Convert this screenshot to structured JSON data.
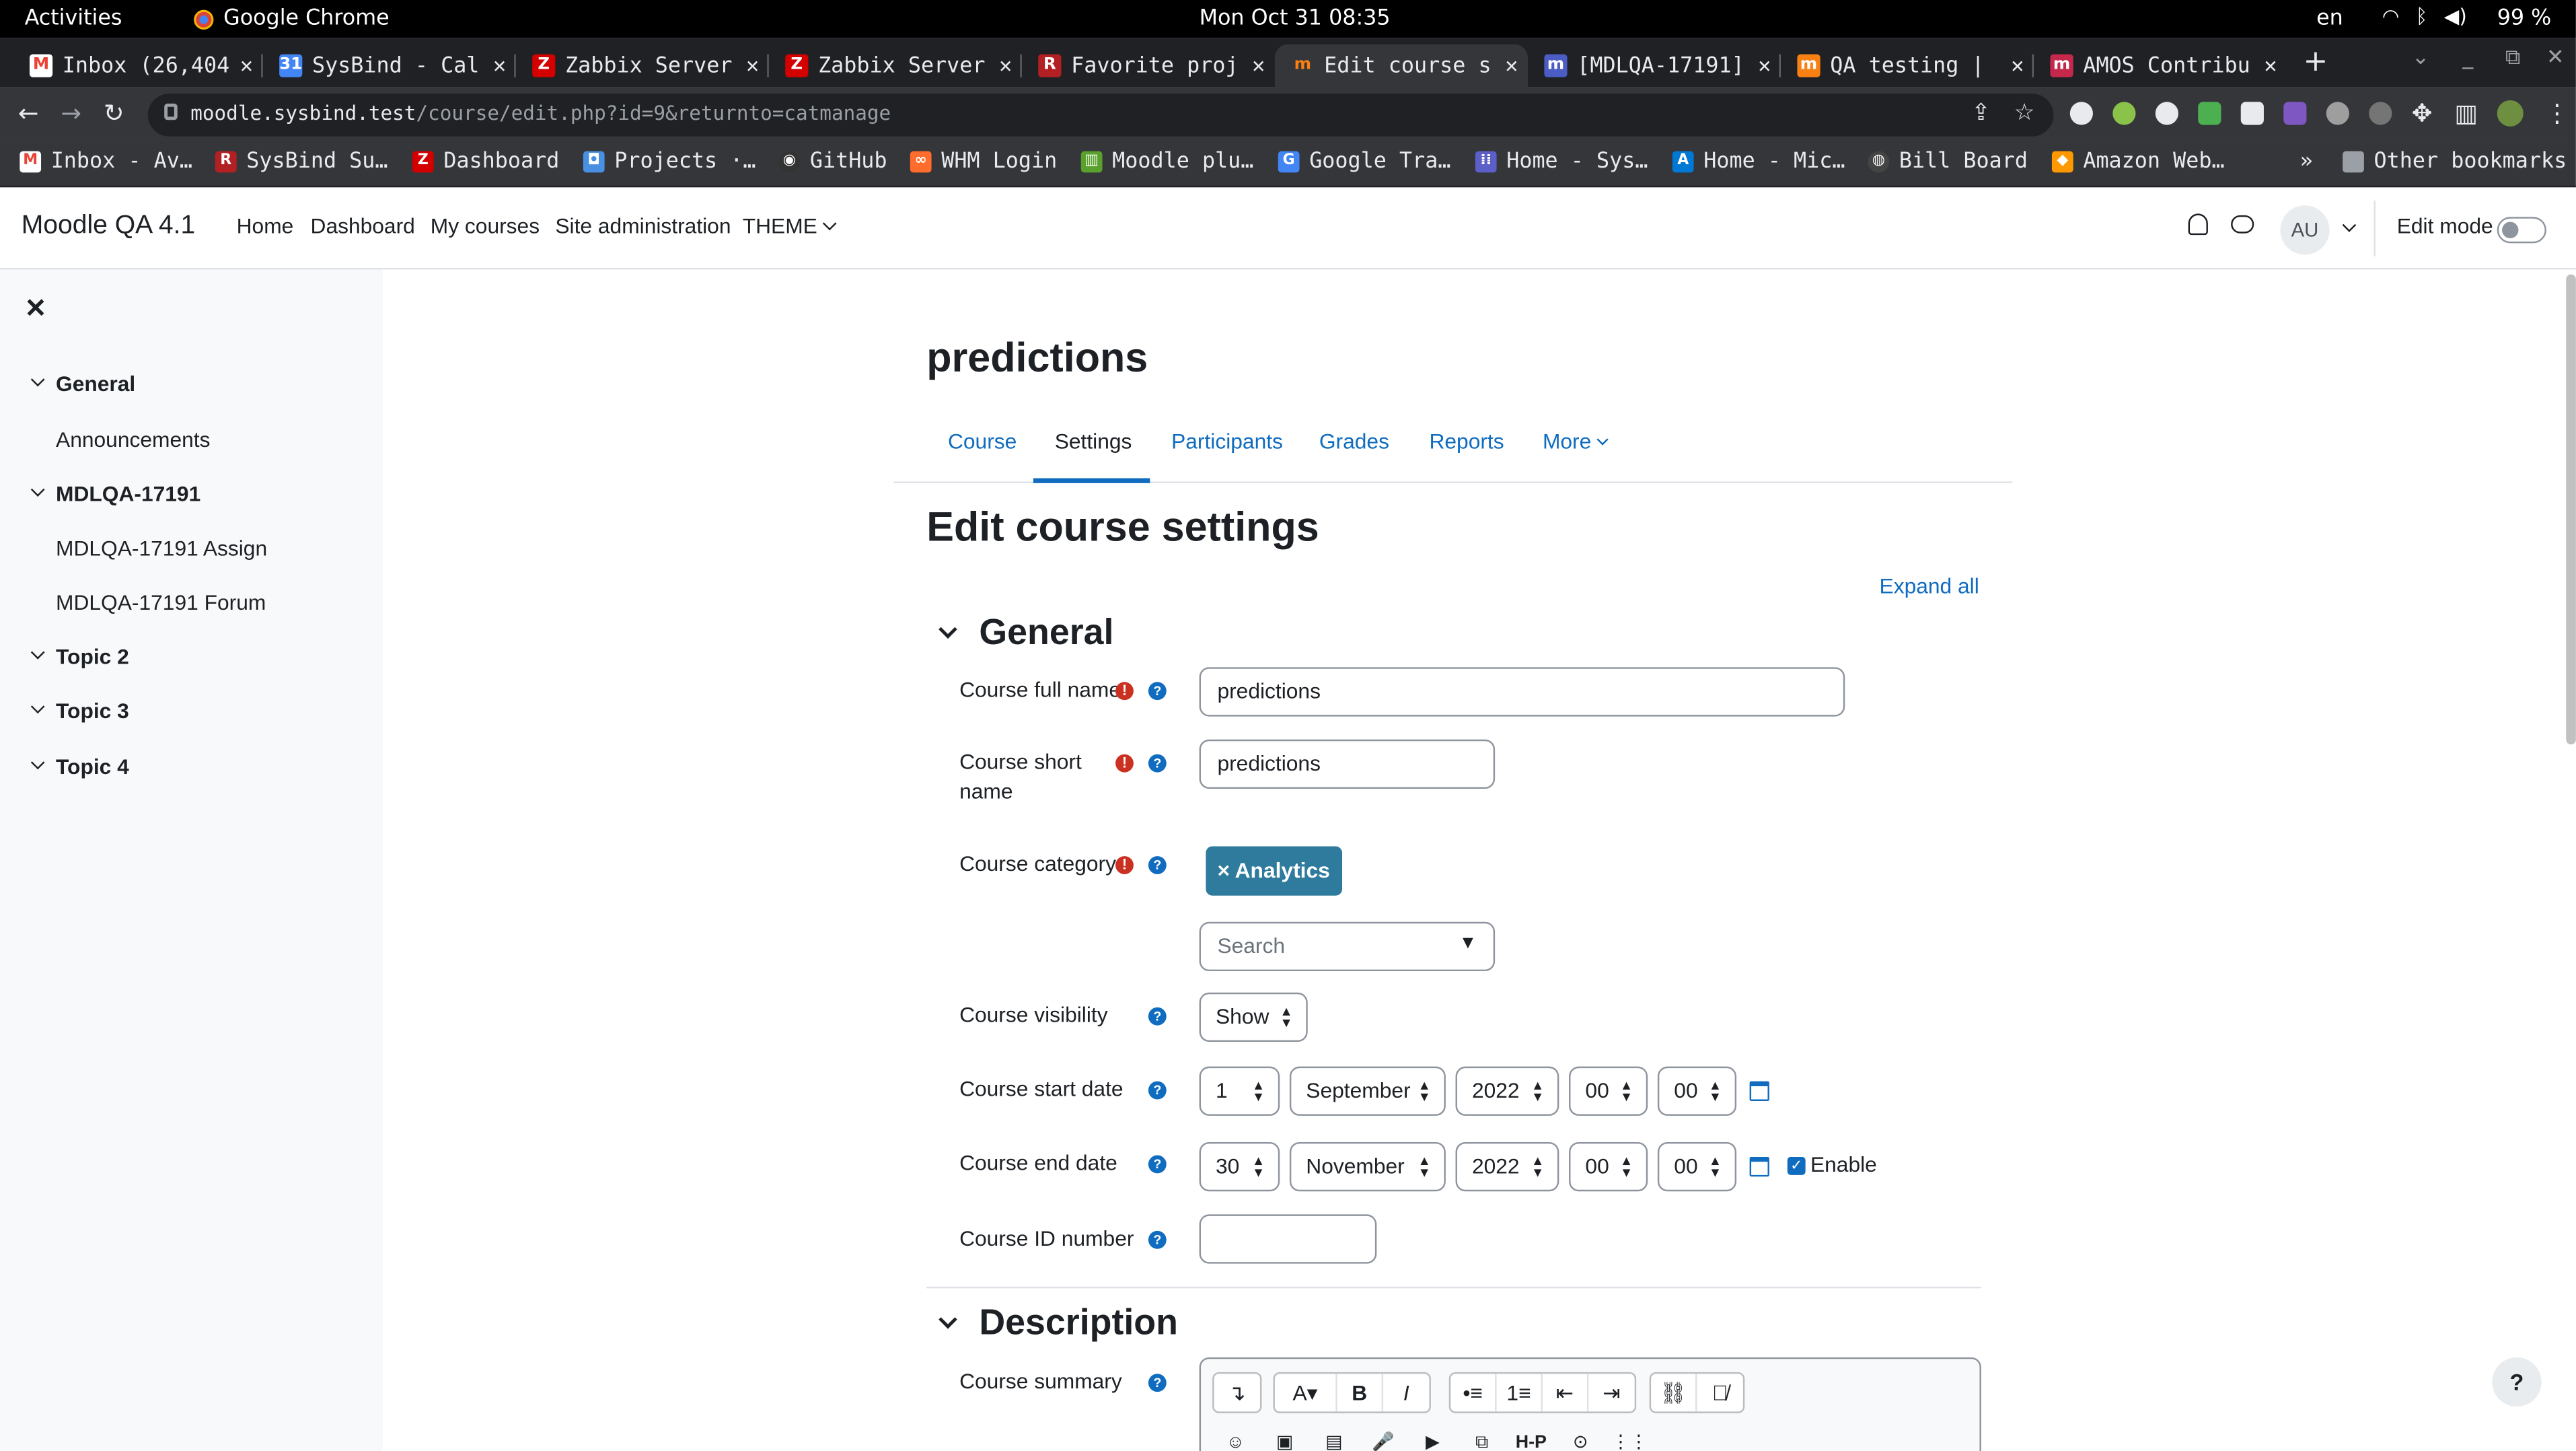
{
  "system": {
    "activities": "Activities",
    "app": "Google Chrome",
    "clock": "Mon Oct 31  08:35",
    "lang": "en",
    "battery": "99 %"
  },
  "tabs": [
    {
      "title": "Inbox (26,404",
      "icon": "gmail-icon",
      "color": "#202124"
    },
    {
      "title": "SysBind - Cal",
      "icon": "calendar-icon",
      "color": "#4285f4"
    },
    {
      "title": "Zabbix Server",
      "icon": "zabbix-icon",
      "color": "#d40000"
    },
    {
      "title": "Zabbix Server",
      "icon": "zabbix-icon",
      "color": "#d40000"
    },
    {
      "title": "Favorite proj",
      "icon": "redmine-icon",
      "color": "#b32024"
    },
    {
      "title": "Edit course s",
      "icon": "moodle-icon",
      "color": "#f98012"
    },
    {
      "title": "[MDLQA-17191]",
      "icon": "tracker-icon",
      "color": "#4c5cc5"
    },
    {
      "title": "QA testing |",
      "icon": "moodle-icon",
      "color": "#f98012"
    },
    {
      "title": "AMOS Contribu",
      "icon": "moodle-icon",
      "color": "#c6284b"
    }
  ],
  "url": {
    "host": "moodle.sysbind.test",
    "path": "/course/edit.php?id=9&returnto=catmanage"
  },
  "bookmarks": [
    {
      "label": "Inbox - Av…",
      "icon": "gmail-icon",
      "color": "#ea4335"
    },
    {
      "label": "SysBind Su…",
      "icon": "redmine-icon",
      "color": "#b32024"
    },
    {
      "label": "Dashboard",
      "icon": "zabbix-icon",
      "color": "#d40000"
    },
    {
      "label": "Projects ·…",
      "icon": "projects-icon",
      "color": "#4a90e2"
    },
    {
      "label": "GitHub",
      "icon": "github-icon",
      "color": "#333333"
    },
    {
      "label": "WHM Login",
      "icon": "whm-icon",
      "color": "#ff6c2c"
    },
    {
      "label": "Moodle plu…",
      "icon": "moodle-icon",
      "color": "#5aa02c"
    },
    {
      "label": "Google Tra…",
      "icon": "translate-icon",
      "color": "#4285f4"
    },
    {
      "label": "Home - Sys…",
      "icon": "grid-icon",
      "color": "#5b5fc7"
    },
    {
      "label": "Home - Mic…",
      "icon": "azure-icon",
      "color": "#0078d4"
    },
    {
      "label": "Bill Board",
      "icon": "globe-icon",
      "color": "#444444"
    },
    {
      "label": "Amazon Web…",
      "icon": "aws-icon",
      "color": "#ff9900"
    }
  ],
  "other_bookmarks": "Other bookmarks",
  "moodle_nav": {
    "brand": "Moodle QA 4.1",
    "links": [
      "Home",
      "Dashboard",
      "My courses",
      "Site administration"
    ],
    "theme": "THEME",
    "avatar": "AU",
    "edit_mode": "Edit mode"
  },
  "course_index": [
    {
      "label": "General",
      "type": "section"
    },
    {
      "label": "Announcements",
      "type": "activity"
    },
    {
      "label": "MDLQA-17191",
      "type": "section"
    },
    {
      "label": "MDLQA-17191 Assign",
      "type": "activity"
    },
    {
      "label": "MDLQA-17191 Forum",
      "type": "activity"
    },
    {
      "label": "Topic 2",
      "type": "section"
    },
    {
      "label": "Topic 3",
      "type": "section"
    },
    {
      "label": "Topic 4",
      "type": "section"
    }
  ],
  "page": {
    "course_title": "predictions",
    "secondary_nav": [
      "Course",
      "Settings",
      "Participants",
      "Grades",
      "Reports",
      "More"
    ],
    "active_tab": "Settings",
    "heading": "Edit course settings",
    "expand_all": "Expand all"
  },
  "form": {
    "general_legend": "General",
    "fullname_label": "Course full name",
    "fullname_value": "predictions",
    "shortname_label_1": "Course short",
    "shortname_label_2": "name",
    "shortname_value": "predictions",
    "category_label": "Course category",
    "category_value": "× Analytics",
    "category_search": "Search",
    "visibility_label": "Course visibility",
    "visibility_value": "Show",
    "start_label": "Course start date",
    "start": {
      "day": "1",
      "month": "September",
      "year": "2022",
      "hour": "00",
      "minute": "00"
    },
    "end_label": "Course end date",
    "end": {
      "day": "30",
      "month": "November",
      "year": "2022",
      "hour": "00",
      "minute": "00"
    },
    "enable_label": "Enable",
    "enable_checked": true,
    "idnumber_label": "Course ID number",
    "idnumber_value": "",
    "description_legend": "Description",
    "summary_label": "Course summary"
  },
  "editor_toolbar": [
    "↴",
    "A▾",
    "B",
    "I",
    "•≡",
    "1≡",
    "⇤",
    "⇥",
    "link",
    "unlink"
  ],
  "editor_toolbar_row2": [
    "☺",
    "▣",
    "▤",
    "🎤",
    "▶",
    "⧉",
    "H-P",
    "⊙",
    "⋮⋮"
  ],
  "help_button": "?"
}
